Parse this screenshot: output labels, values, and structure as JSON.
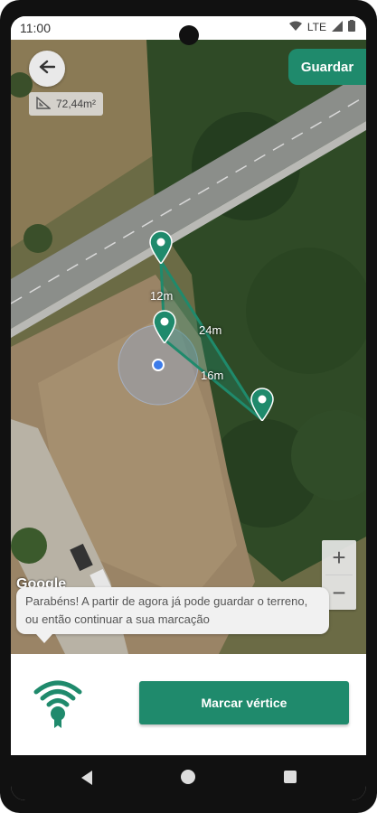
{
  "status_bar": {
    "time": "11:00",
    "network": "LTE"
  },
  "header": {
    "save_label": "Guardar"
  },
  "area": {
    "value": "72,44m²"
  },
  "measurements": {
    "side_a": "12m",
    "side_b": "24m",
    "side_c": "16m"
  },
  "map": {
    "attribution": "Google",
    "zoom_in": "+",
    "zoom_out": "−"
  },
  "toast": {
    "message": "Parabéns! A partir de agora já pode guardar o terreno, ou então continuar a sua marcação"
  },
  "actions": {
    "mark_vertex_label": "Marcar vértice"
  },
  "colors": {
    "accent": "#1f8a6c"
  }
}
